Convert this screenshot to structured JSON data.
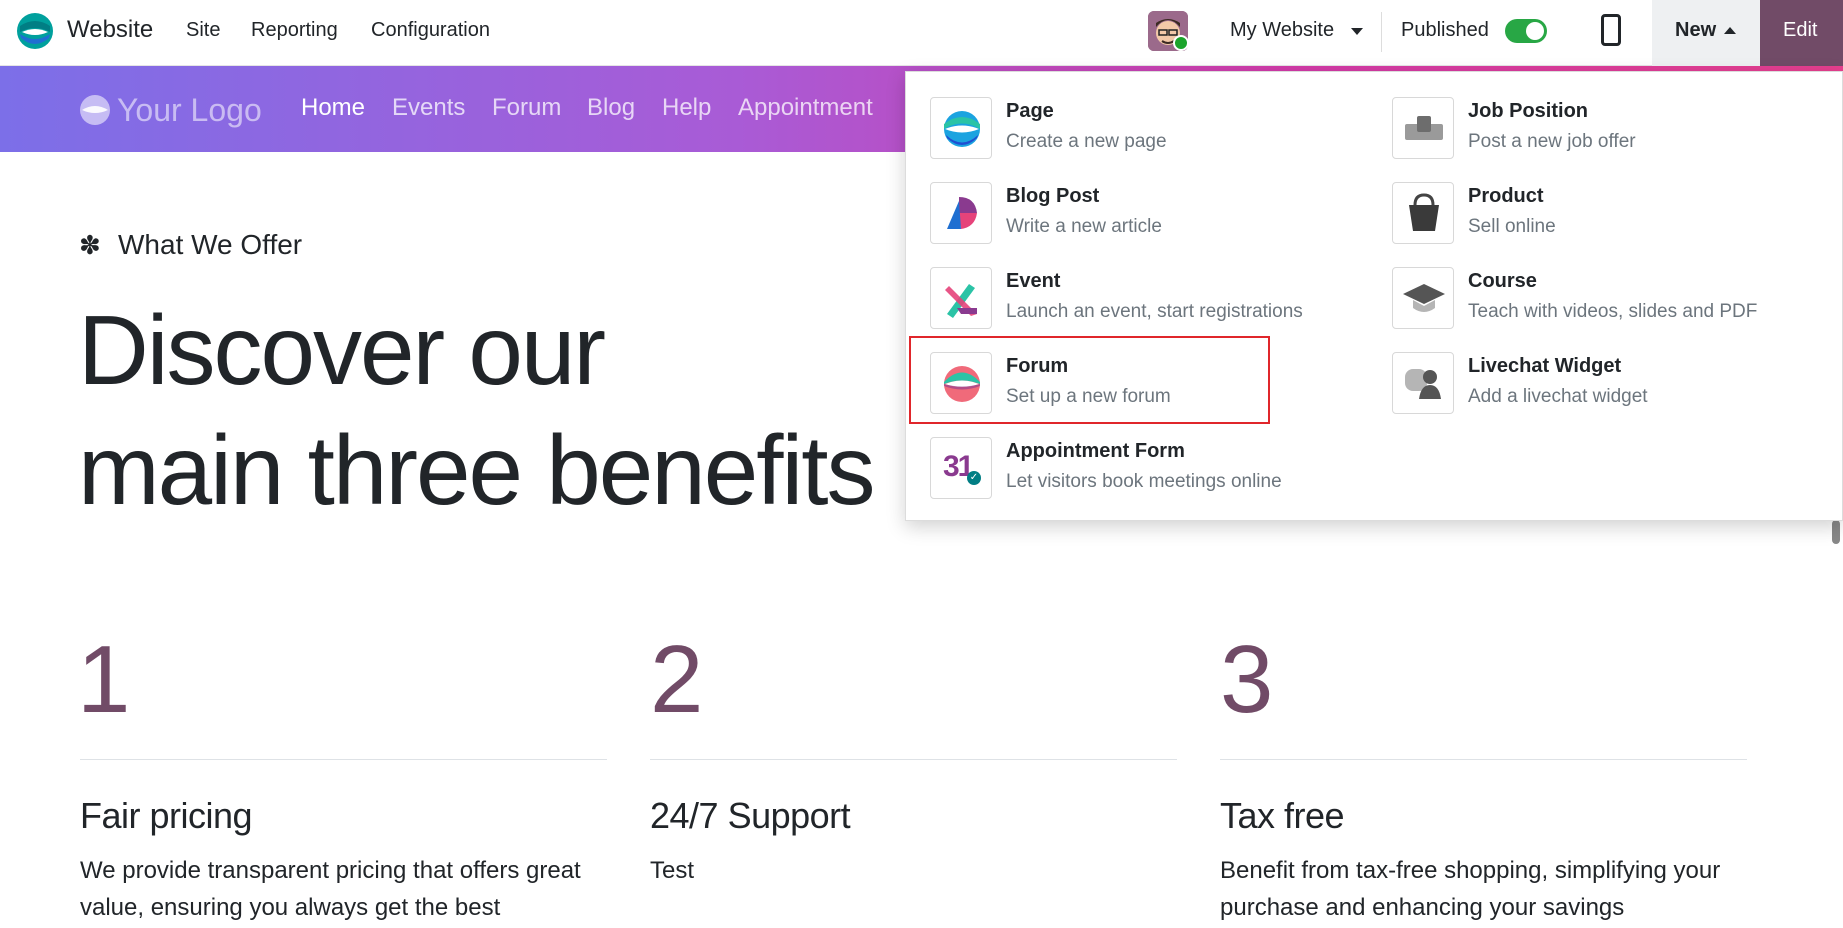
{
  "topbar": {
    "app_name": "Website",
    "menus": [
      "Site",
      "Reporting",
      "Configuration"
    ],
    "website_selector": "My Website",
    "published_label": "Published",
    "published": true,
    "new_label": "New",
    "edit_label": "Edit"
  },
  "site_header": {
    "logo_text": "Your Logo",
    "nav": [
      "Home",
      "Events",
      "Forum",
      "Blog",
      "Help",
      "Appointment"
    ],
    "active": "Home"
  },
  "hero": {
    "eyebrow_icon": "✽",
    "eyebrow": "What We Offer",
    "line1": "Discover our",
    "line2": "main three benefits"
  },
  "benefits": [
    {
      "number": "1",
      "title": "Fair pricing",
      "text": "We provide transparent pricing that offers great value, ensuring you always get the best"
    },
    {
      "number": "2",
      "title": "24/7 Support",
      "text": "Test"
    },
    {
      "number": "3",
      "title": "Tax free",
      "text": "Benefit from tax-free shopping, simplifying your purchase and enhancing your savings"
    }
  ],
  "new_menu": {
    "left": [
      {
        "title": "Page",
        "subtitle": "Create a new page",
        "icon": "page-icon"
      },
      {
        "title": "Blog Post",
        "subtitle": "Write a new article",
        "icon": "blog-icon"
      },
      {
        "title": "Event",
        "subtitle": "Launch an event, start registrations",
        "icon": "event-icon"
      },
      {
        "title": "Forum",
        "subtitle": "Set up a new forum",
        "icon": "forum-icon"
      },
      {
        "title": "Appointment Form",
        "subtitle": "Let visitors book meetings online",
        "icon": "appointment-icon",
        "icon_text": "31"
      }
    ],
    "right": [
      {
        "title": "Job Position",
        "subtitle": "Post a new job offer",
        "icon": "job-icon"
      },
      {
        "title": "Product",
        "subtitle": "Sell online",
        "icon": "shopping-bag-icon"
      },
      {
        "title": "Course",
        "subtitle": "Teach with videos, slides and PDF",
        "icon": "graduation-cap-icon"
      },
      {
        "title": "Livechat Widget",
        "subtitle": "Add a livechat widget",
        "icon": "livechat-icon"
      }
    ],
    "highlighted": "Forum"
  },
  "colors": {
    "brand": "#714b67",
    "highlight_border": "#e0262b",
    "toggle_on": "#28a745"
  }
}
